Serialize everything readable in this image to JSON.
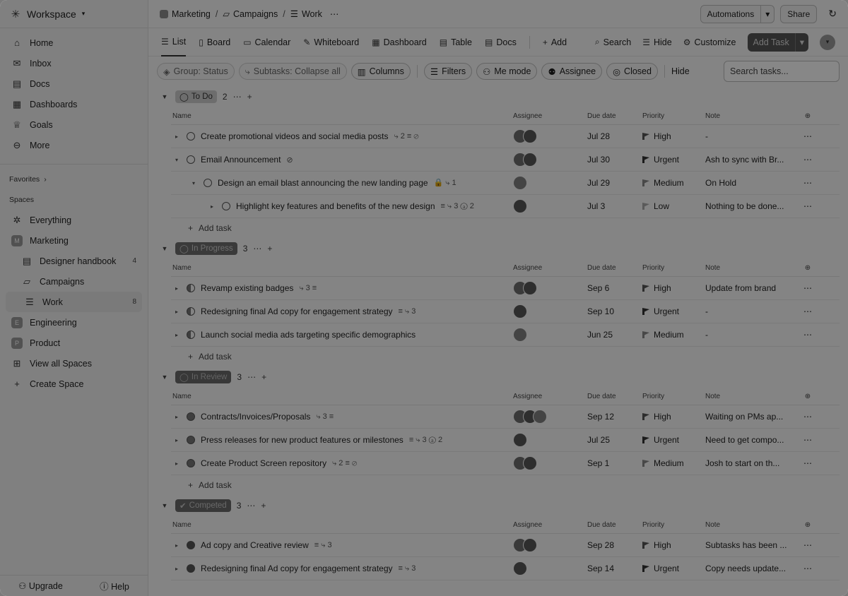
{
  "workspace": {
    "name": "Workspace"
  },
  "sidebar": {
    "nav": [
      {
        "label": "Home",
        "icon": "home-icon",
        "glyph": "⌂"
      },
      {
        "label": "Inbox",
        "icon": "inbox-icon",
        "glyph": "✉"
      },
      {
        "label": "Docs",
        "icon": "doc-icon",
        "glyph": "▤"
      },
      {
        "label": "Dashboards",
        "icon": "dashboard-icon",
        "glyph": "▦"
      },
      {
        "label": "Goals",
        "icon": "trophy-icon",
        "glyph": "♕"
      },
      {
        "label": "More",
        "icon": "more-icon",
        "glyph": "⊖"
      }
    ],
    "favorites": "Favorites",
    "spaces": "Spaces",
    "space_items": [
      {
        "label": "Everything",
        "icon": "everything-icon",
        "glyph": "✲"
      },
      {
        "label": "Marketing",
        "icon": "marketing-space-icon",
        "badge": "M"
      }
    ],
    "marketing_children": [
      {
        "label": "Designer handbook",
        "count": "4",
        "icon": "doc-icon",
        "glyph": "▤"
      },
      {
        "label": "Campaigns",
        "icon": "folder-icon",
        "glyph": "▱"
      }
    ],
    "work": {
      "label": "Work",
      "count": "8"
    },
    "other_spaces": [
      {
        "label": "Engineering",
        "badge": "E"
      },
      {
        "label": "Product",
        "badge": "P"
      }
    ],
    "view_all": "View all Spaces",
    "create_space": "Create Space",
    "upgrade": "Upgrade",
    "help": "Help"
  },
  "topbar": {
    "crumbs": [
      "Marketing",
      "Campaigns",
      "Work"
    ],
    "automations": "Automations",
    "share": "Share"
  },
  "views": {
    "tabs": [
      "List",
      "Board",
      "Calendar",
      "Whiteboard",
      "Dashboard",
      "Table",
      "Docs"
    ],
    "add": "Add",
    "search": "Search",
    "hide": "Hide",
    "customize": "Customize",
    "add_task": "Add Task"
  },
  "filters": {
    "group": "Group: Status",
    "subtasks": "Subtasks: Collapse all",
    "columns": "Columns",
    "filters": "Filters",
    "me_mode": "Me mode",
    "assignee": "Assignee",
    "closed": "Closed",
    "hide": "Hide",
    "search_placeholder": "Search tasks..."
  },
  "columns": {
    "name": "Name",
    "assignee": "Assignee",
    "due": "Due date",
    "priority": "Priority",
    "note": "Note"
  },
  "add_task_label": "Add task",
  "groups": [
    {
      "status": "To Do",
      "count": "2",
      "rows": [
        {
          "name": "Create promotional videos and social media posts",
          "meta": "⤷ 2  ≡  ⊘",
          "due": "Jul 28",
          "priority": "High",
          "note": "-",
          "level": 0,
          "caret": "▸"
        },
        {
          "name": "Email Announcement",
          "meta": "⊘",
          "due": "Jul 30",
          "priority": "Urgent",
          "note": "Ash to sync with Br...",
          "level": 0,
          "caret": "▾"
        },
        {
          "name": "Design an email blast announcing the new landing page",
          "meta": "🔒  ⤷ 1",
          "due": "Jul 29",
          "priority": "Medium",
          "note": "On Hold",
          "level": 1,
          "caret": "▾"
        },
        {
          "name": "Highlight key features and benefits of the new design",
          "meta": "≡  ⤷ 3  ⓐ 2",
          "due": "Jul 3",
          "priority": "Low",
          "note": "Nothing to be done...",
          "level": 2,
          "caret": "▸"
        }
      ]
    },
    {
      "status": "In Progress",
      "count": "3",
      "rows": [
        {
          "name": "Revamp existing badges",
          "meta": "⤷ 3  ≡",
          "due": "Sep 6",
          "priority": "High",
          "note": "Update from brand",
          "level": 0,
          "caret": "▸"
        },
        {
          "name": "Redesigning final Ad copy for engagement strategy",
          "meta": "≡  ⤷ 3",
          "due": "Sep 10",
          "priority": "Urgent",
          "note": "-",
          "level": 0,
          "caret": "▸"
        },
        {
          "name": "Launch social media ads targeting specific demographics",
          "meta": "",
          "due": "Jun 25",
          "priority": "Medium",
          "note": "-",
          "level": 0,
          "caret": "▸"
        }
      ]
    },
    {
      "status": "In Review",
      "count": "3",
      "rows": [
        {
          "name": "Contracts/Invoices/Proposals",
          "meta": "⤷ 3  ≡",
          "due": "Sep 12",
          "priority": "High",
          "note": "Waiting on PMs ap...",
          "level": 0,
          "caret": "▸"
        },
        {
          "name": "Press releases for new product features or milestones",
          "meta": "≡  ⤷ 3  ⓐ 2",
          "due": "Jul 25",
          "priority": "Urgent",
          "note": "Need to get compo...",
          "level": 0,
          "caret": "▸"
        },
        {
          "name": "Create Product Screen repository",
          "meta": "⤷ 2  ≡  ⊘",
          "due": "Sep 1",
          "priority": "Medium",
          "note": "Josh to start on th...",
          "level": 0,
          "caret": "▸"
        }
      ]
    },
    {
      "status": "Competed",
      "count": "3",
      "rows": [
        {
          "name": "Ad copy and Creative review",
          "meta": "≡  ⤷ 3",
          "due": "Sep 28",
          "priority": "High",
          "note": "Subtasks has been ...",
          "level": 0,
          "caret": "▸"
        },
        {
          "name": "Redesigning final Ad copy for engagement strategy",
          "meta": "≡  ⤷ 3",
          "due": "Sep 14",
          "priority": "Urgent",
          "note": "Copy needs update...",
          "level": 0,
          "caret": "▸"
        }
      ]
    }
  ]
}
